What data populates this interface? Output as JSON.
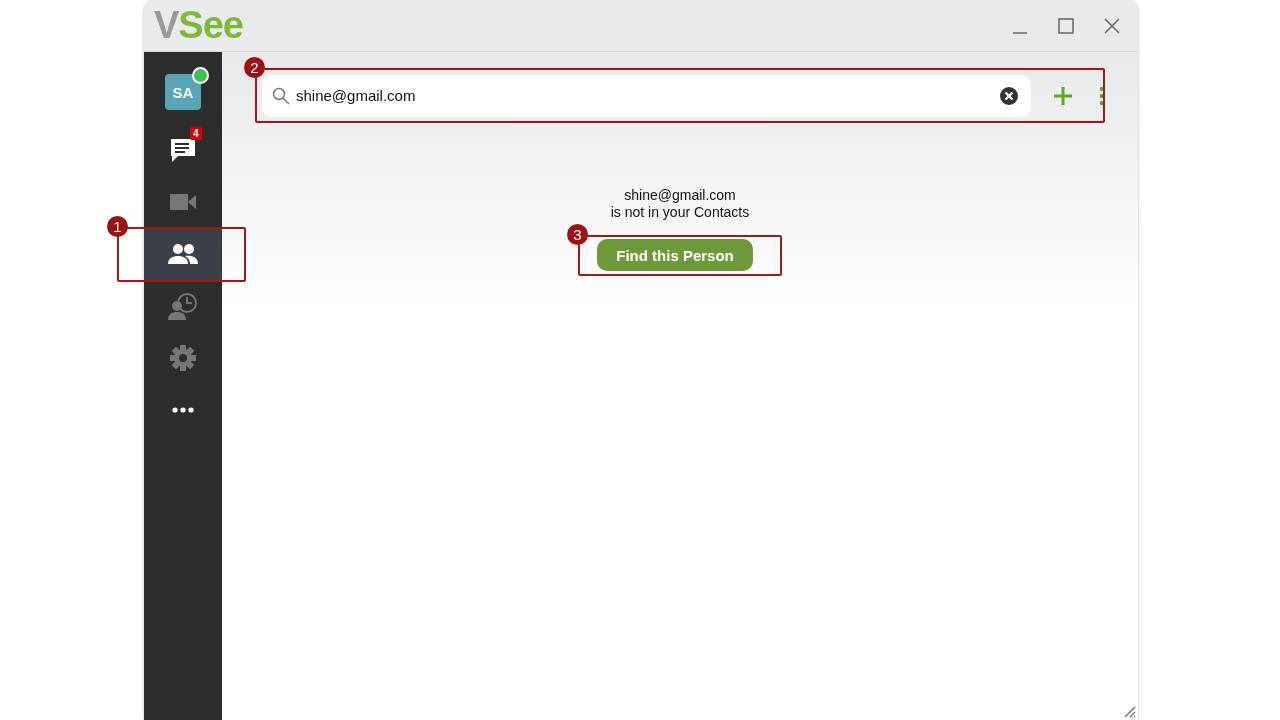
{
  "window": {
    "logo_prefix": "V",
    "logo_rest": "See"
  },
  "sidebar": {
    "avatar": {
      "initials": "SA",
      "online": true
    },
    "items": [
      {
        "kind": "chat",
        "badge": "4",
        "selected": false
      },
      {
        "kind": "video",
        "selected": false
      },
      {
        "kind": "contacts",
        "selected": true,
        "callout": "1"
      },
      {
        "kind": "history",
        "selected": false
      },
      {
        "kind": "settings",
        "selected": false
      },
      {
        "kind": "more",
        "selected": false
      }
    ]
  },
  "search": {
    "value": "shine@gmail.com",
    "callout": "2"
  },
  "message": {
    "email": "shine@gmail.com",
    "text": "is not in your Contacts"
  },
  "find_button": {
    "label": "Find this Person",
    "callout": "3"
  }
}
